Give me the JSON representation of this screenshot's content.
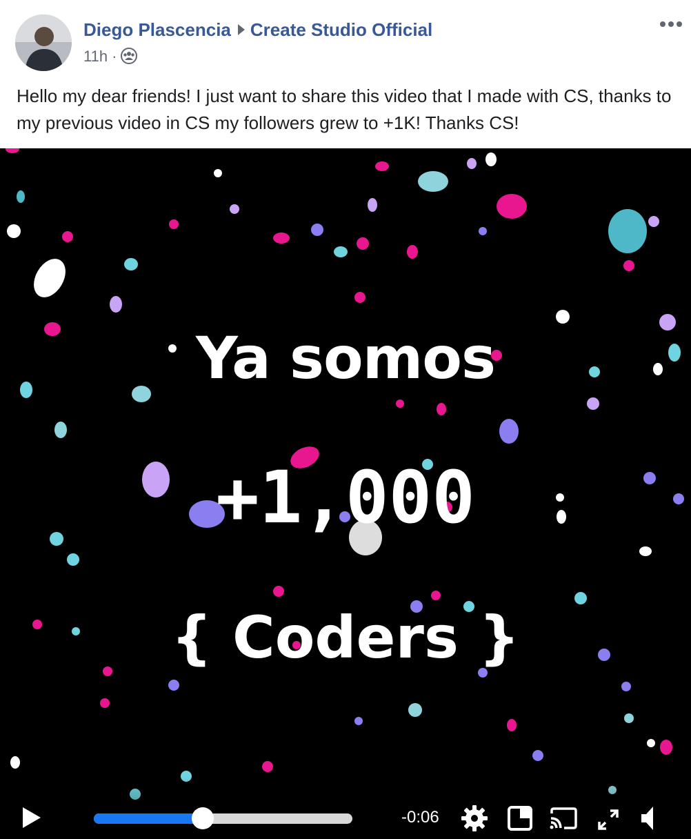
{
  "post": {
    "author": "Diego Plascencia",
    "group": "Create Studio Official",
    "time": "11h",
    "separator": "·",
    "text": "Hello my dear friends! I just want to share this video that I made with CS, thanks to my previous video in CS my followers grew to +1K! Thanks CS!"
  },
  "video": {
    "line1": "Ya somos",
    "line2": "+1,000",
    "line3": "{ Coders }",
    "time_remaining": "-0:06",
    "progress": 0.42
  },
  "icons": {
    "more": "more-icon",
    "audience": "group-audience-icon",
    "play": "play-icon",
    "settings": "gear-icon",
    "pip": "picture-in-picture-icon",
    "cast": "cast-icon",
    "fullscreen": "fullscreen-icon",
    "volume": "volume-icon"
  },
  "colors": {
    "link": "#385898",
    "progress": "#1877f2",
    "confetti": [
      "#e8168f",
      "#6fd3e0",
      "#8a7ef0",
      "#ffffff",
      "#c9a3f5"
    ]
  }
}
